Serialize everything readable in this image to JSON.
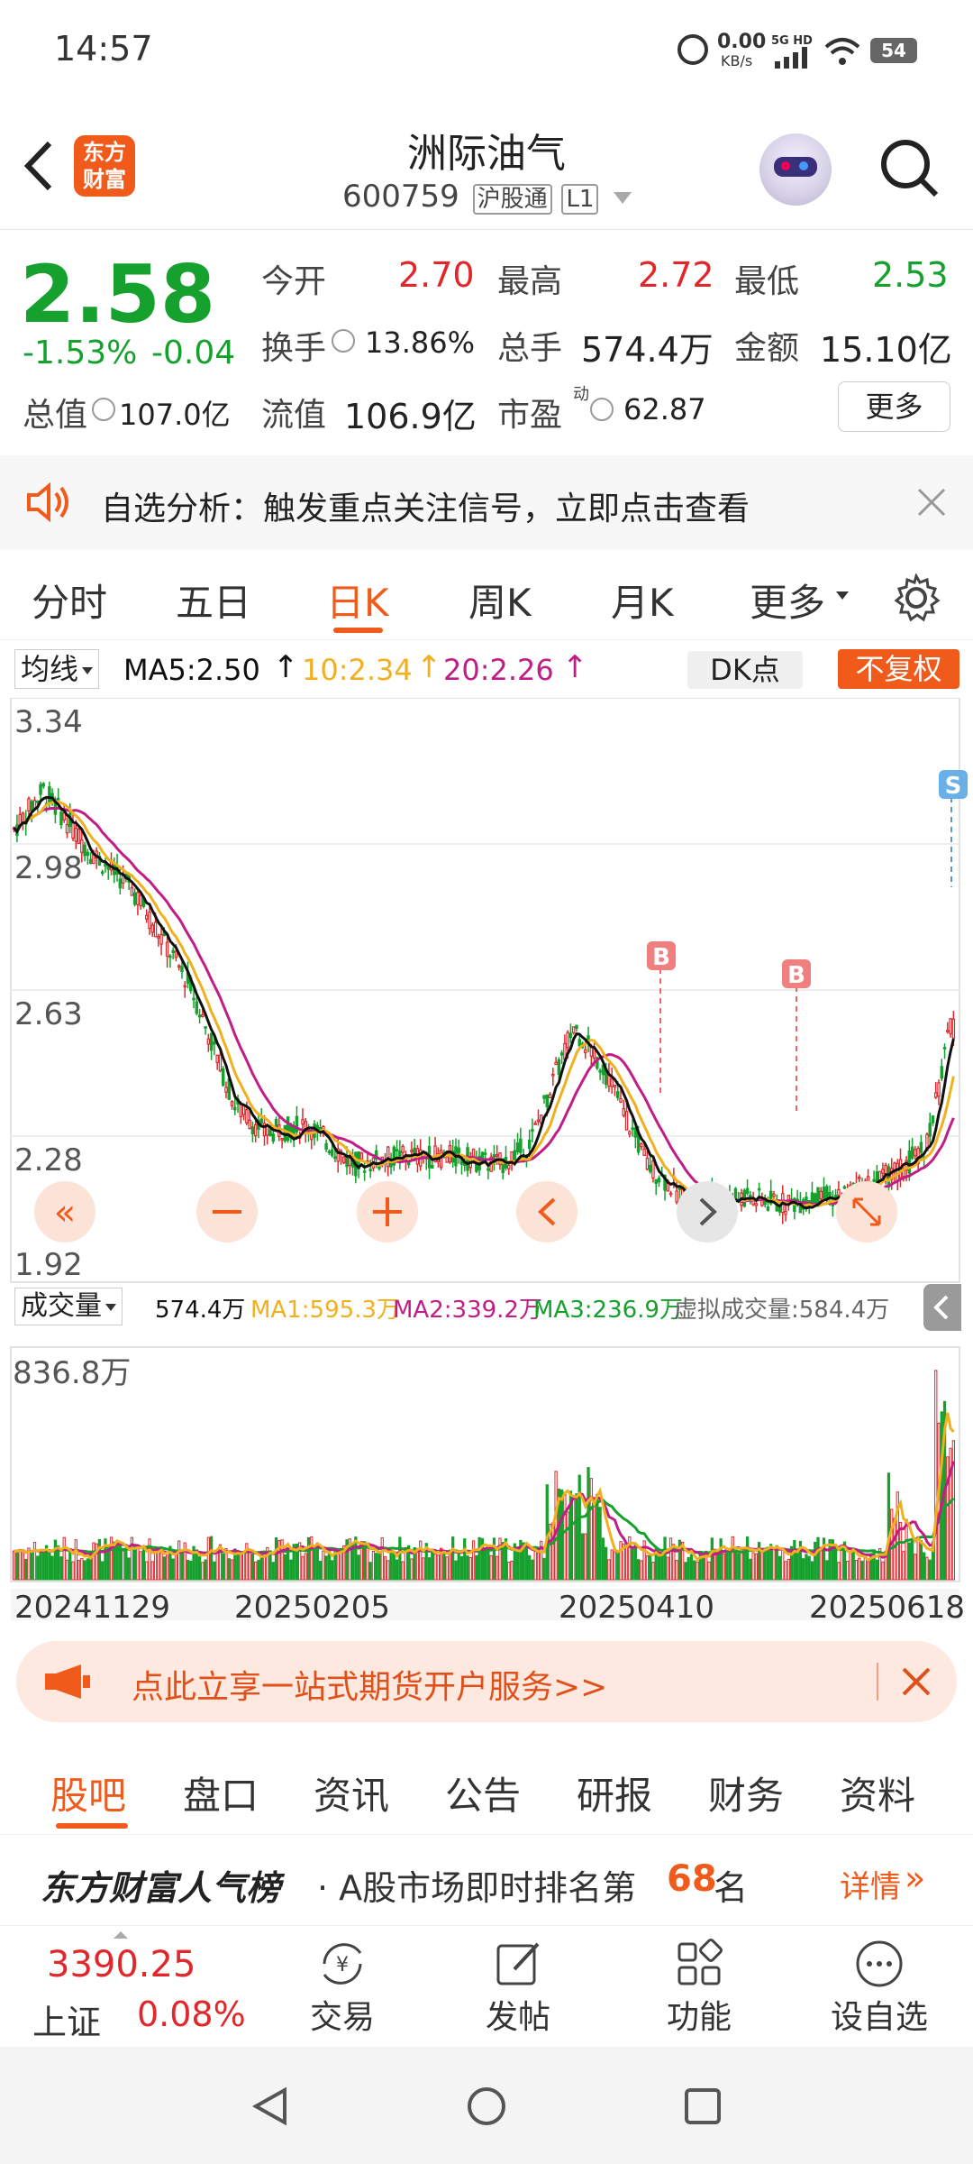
{
  "status": {
    "time": "14:57",
    "net_speed_value": "0.00",
    "net_speed_unit": "KB/s",
    "network": "5G HD",
    "battery": "54"
  },
  "header": {
    "stock_name": "洲际油气",
    "code": "600759",
    "exchange_tag": "沪股通",
    "level_tag": "L1",
    "logo_line1": "东方",
    "logo_line2": "财富"
  },
  "quote": {
    "price": "2.58",
    "change_pct": "-1.53%",
    "change": "-0.04",
    "open_label": "今开",
    "open": "2.70",
    "high_label": "最高",
    "high": "2.72",
    "low_label": "最低",
    "low": "2.53",
    "turnover_label": "换手",
    "turnover": "13.86%",
    "volume_label": "总手",
    "volume": "574.4万",
    "amount_label": "金额",
    "amount": "15.10亿",
    "mktcap_label": "总值",
    "mktcap": "107.0亿",
    "float_label": "流值",
    "float": "106.9亿",
    "pe_label": "市盈",
    "pe_sup": "动",
    "pe": "62.87",
    "more_label": "更多"
  },
  "banner": {
    "text": "自选分析：触发重点关注信号，立即点击查看"
  },
  "tabs": [
    "分时",
    "五日",
    "日K",
    "周K",
    "月K",
    "更多"
  ],
  "active_tab": "日K",
  "chart": {
    "ma_select": "均线",
    "ma5": "MA5:2.50",
    "ma10": "10:2.34",
    "ma20": "20:2.26",
    "dk_label": "DK点",
    "fq_label": "不复权",
    "y_labels": [
      "3.34",
      "2.98",
      "2.63",
      "2.28",
      "1.92"
    ],
    "vol_select": "成交量",
    "vol": "574.4万",
    "vma1": "MA1:595.3万",
    "vma2": "MA2:339.2万",
    "vma3": "MA3:236.9万",
    "virtual_vol": "虚拟成交量:584.4万",
    "vol_max": "836.8万",
    "dates": [
      "20241129",
      "20250205",
      "20250410",
      "20250618"
    ],
    "signal_b": "B",
    "signal_s": "S",
    "colors": {
      "ma5": "#111111",
      "ma10": "#f0b020",
      "ma20": "#c01e86",
      "vma1": "#f0b020",
      "vma2": "#c01e86",
      "vma3": "#16a02e"
    }
  },
  "promo": {
    "text": "点此立享一站式期货开户服务>>"
  },
  "subtabs": [
    "股吧",
    "盘口",
    "资讯",
    "公告",
    "研报",
    "财务",
    "资料"
  ],
  "active_subtab": "股吧",
  "rank": {
    "brand": "东方财富人气榜",
    "prefix": "· A股市场即时排名第",
    "rank": "68",
    "suffix": "名",
    "detail": "详情"
  },
  "bottom": {
    "index_value": "3390.25",
    "index_name": "上证",
    "index_change": "0.08%",
    "trade": "交易",
    "post": "发帖",
    "function": "功能",
    "watch": "设自选"
  }
}
